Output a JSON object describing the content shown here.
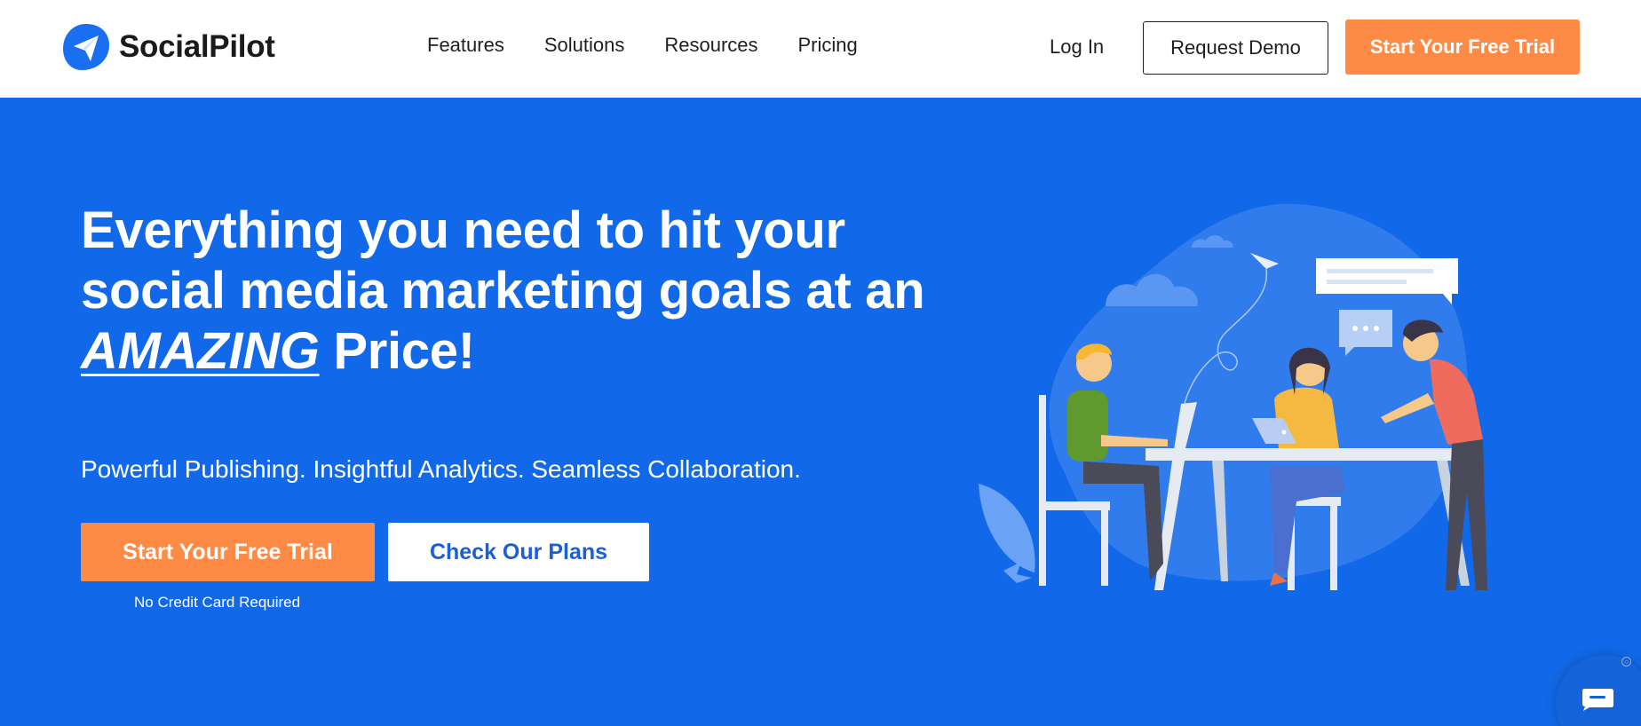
{
  "brand": {
    "name": "SocialPilot",
    "accent": "#1169e9",
    "cta_color": "#fd8a45"
  },
  "nav": {
    "items": [
      "Features",
      "Solutions",
      "Resources",
      "Pricing"
    ]
  },
  "header": {
    "login_label": "Log In",
    "demo_label": "Request Demo",
    "trial_label": "Start Your Free Trial"
  },
  "hero": {
    "title_line1": "Everything you need to hit your",
    "title_line2": "social media marketing goals at an",
    "title_emphasis": "AMAZING",
    "title_end": "Price!",
    "subtitle": "Powerful Publishing. Insightful Analytics. Seamless Collaboration.",
    "trial_label": "Start Your Free Trial",
    "plans_label": "Check Our Plans",
    "note": "No Credit Card Required"
  },
  "chat": {
    "icon": "chat-bubble-icon"
  }
}
